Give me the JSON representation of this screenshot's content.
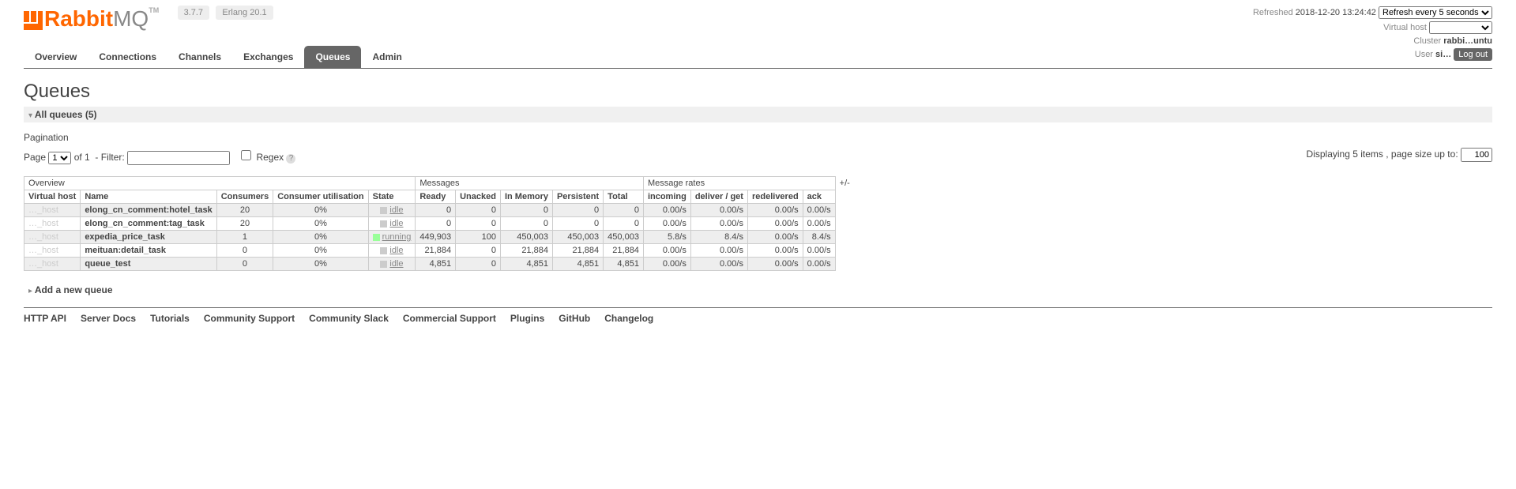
{
  "logo": {
    "rabbit": "Rabbit",
    "mq": "MQ",
    "tm": "TM"
  },
  "versions": {
    "rabbitmq": "3.7.7",
    "erlang": "Erlang 20.1"
  },
  "topnav": {
    "refreshed_label": "Refreshed",
    "refreshed_time": "2018-12-20 13:24:42",
    "refresh_select": "Refresh every 5 seconds",
    "vhost_label": "Virtual host",
    "vhost_select": "",
    "cluster_label": "Cluster",
    "cluster_value": "rabbi…untu",
    "user_label": "User",
    "user_value": "si…",
    "logout": "Log out"
  },
  "menu": [
    "Overview",
    "Connections",
    "Channels",
    "Exchanges",
    "Queues",
    "Admin"
  ],
  "menu_selected": 4,
  "title": "Queues",
  "all_queues": "All queues (5)",
  "pagination_label": "Pagination",
  "page_label": "Page",
  "page_current": "1",
  "page_of": "of 1",
  "filter_label": "- Filter:",
  "regex_label": "Regex",
  "displaying": "Displaying 5 items , page size up to:",
  "page_size": "100",
  "group_headers": [
    "Overview",
    "Messages",
    "Message rates",
    "+/-"
  ],
  "col_headers": [
    "Virtual host",
    "Name",
    "Consumers",
    "Consumer utilisation",
    "State",
    "Ready",
    "Unacked",
    "In Memory",
    "Persistent",
    "Total",
    "incoming",
    "deliver / get",
    "redelivered",
    "ack"
  ],
  "rows": [
    {
      "vhost": "…_host",
      "name": "elong_cn_comment:hotel_task",
      "consumers": "20",
      "util": "0%",
      "state": "idle",
      "ready": "0",
      "unacked": "0",
      "inmem": "0",
      "persist": "0",
      "total": "0",
      "incoming": "0.00/s",
      "deliver": "0.00/s",
      "redeliv": "0.00/s",
      "ack": "0.00/s"
    },
    {
      "vhost": "…_host",
      "name": "elong_cn_comment:tag_task",
      "consumers": "20",
      "util": "0%",
      "state": "idle",
      "ready": "0",
      "unacked": "0",
      "inmem": "0",
      "persist": "0",
      "total": "0",
      "incoming": "0.00/s",
      "deliver": "0.00/s",
      "redeliv": "0.00/s",
      "ack": "0.00/s"
    },
    {
      "vhost": "…_host",
      "name": "expedia_price_task",
      "consumers": "1",
      "util": "0%",
      "state": "running",
      "ready": "449,903",
      "unacked": "100",
      "inmem": "450,003",
      "persist": "450,003",
      "total": "450,003",
      "incoming": "5.8/s",
      "deliver": "8.4/s",
      "redeliv": "0.00/s",
      "ack": "8.4/s"
    },
    {
      "vhost": "…_host",
      "name": "meituan:detail_task",
      "consumers": "0",
      "util": "0%",
      "state": "idle",
      "ready": "21,884",
      "unacked": "0",
      "inmem": "21,884",
      "persist": "21,884",
      "total": "21,884",
      "incoming": "0.00/s",
      "deliver": "0.00/s",
      "redeliv": "0.00/s",
      "ack": "0.00/s"
    },
    {
      "vhost": "…_host",
      "name": "queue_test",
      "consumers": "0",
      "util": "0%",
      "state": "idle",
      "ready": "4,851",
      "unacked": "0",
      "inmem": "4,851",
      "persist": "4,851",
      "total": "4,851",
      "incoming": "0.00/s",
      "deliver": "0.00/s",
      "redeliv": "0.00/s",
      "ack": "0.00/s"
    }
  ],
  "add_queue": "Add a new queue",
  "footer_links": [
    "HTTP API",
    "Server Docs",
    "Tutorials",
    "Community Support",
    "Community Slack",
    "Commercial Support",
    "Plugins",
    "GitHub",
    "Changelog"
  ]
}
